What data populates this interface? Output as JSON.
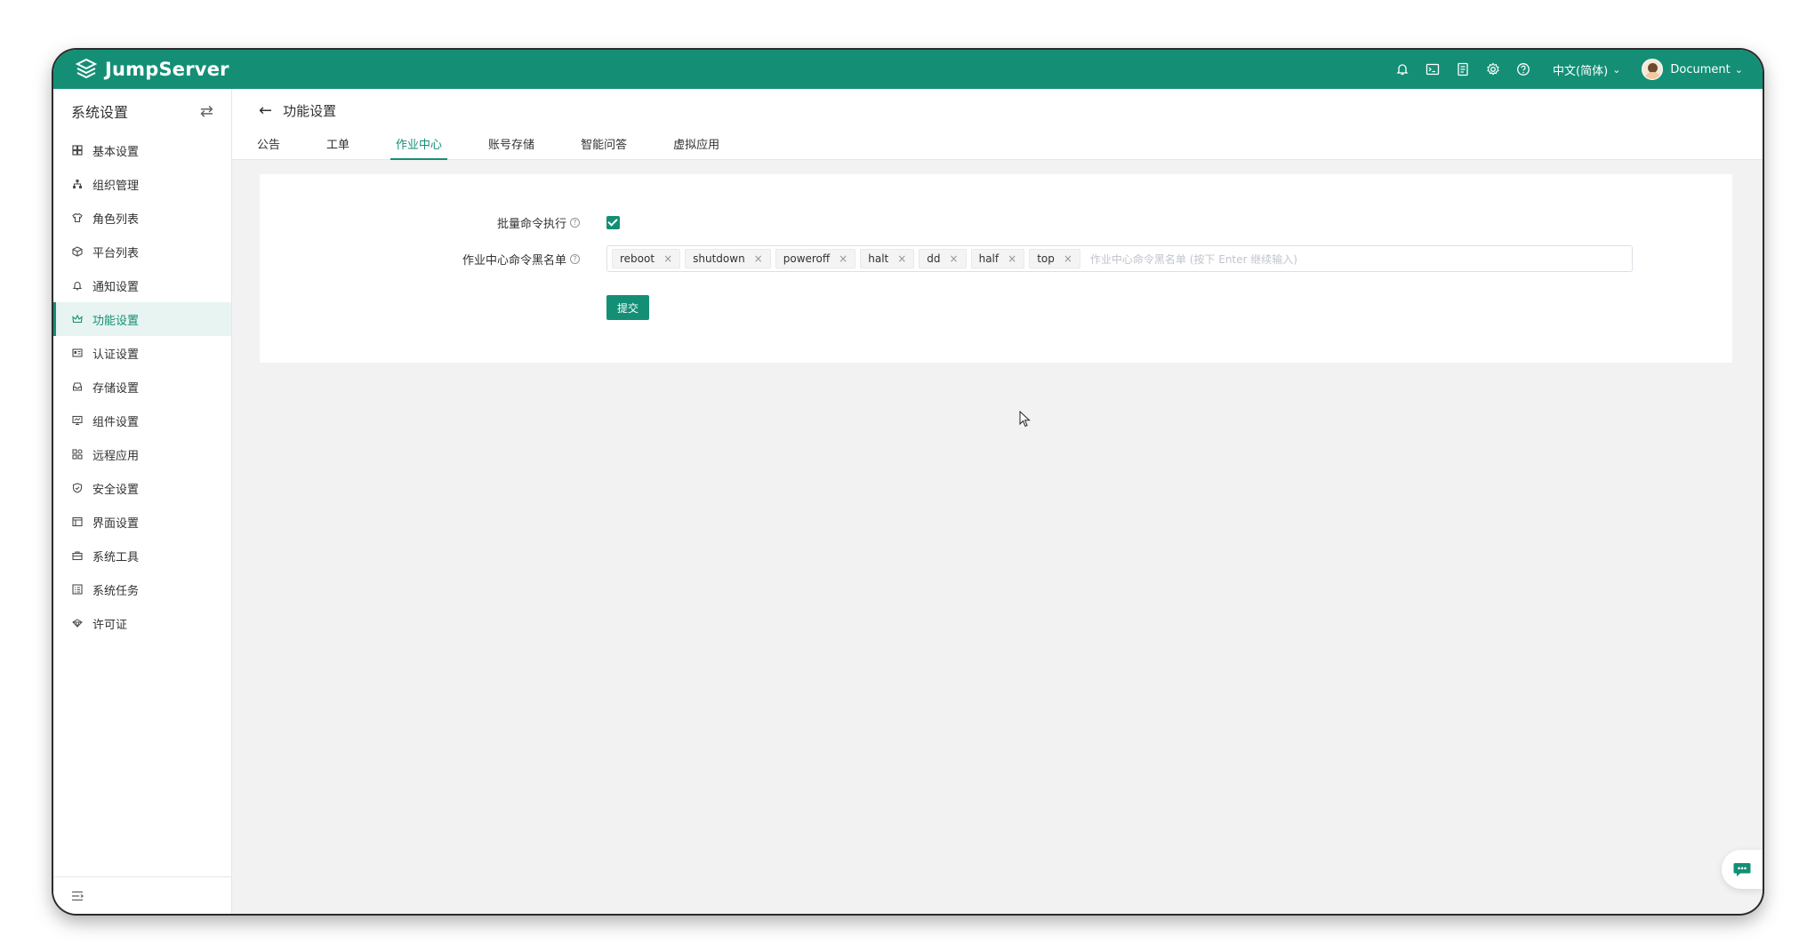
{
  "header": {
    "brand": "JumpServer",
    "language": "中文(简体)",
    "user": "Document"
  },
  "sidebar": {
    "title": "系统设置",
    "items": [
      {
        "label": "基本设置",
        "icon": "grid-icon"
      },
      {
        "label": "组织管理",
        "icon": "org-tree-icon"
      },
      {
        "label": "角色列表",
        "icon": "shirt-icon"
      },
      {
        "label": "平台列表",
        "icon": "cube-icon"
      },
      {
        "label": "通知设置",
        "icon": "bell-icon"
      },
      {
        "label": "功能设置",
        "icon": "crown-icon"
      },
      {
        "label": "认证设置",
        "icon": "id-card-icon"
      },
      {
        "label": "存储设置",
        "icon": "inbox-icon"
      },
      {
        "label": "组件设置",
        "icon": "monitor-icon"
      },
      {
        "label": "远程应用",
        "icon": "apps-icon"
      },
      {
        "label": "安全设置",
        "icon": "shield-icon"
      },
      {
        "label": "界面设置",
        "icon": "layout-icon"
      },
      {
        "label": "系统工具",
        "icon": "toolbox-icon"
      },
      {
        "label": "系统任务",
        "icon": "task-list-icon"
      },
      {
        "label": "许可证",
        "icon": "license-icon"
      }
    ],
    "active_index": 5
  },
  "page": {
    "title": "功能设置",
    "tabs": [
      "公告",
      "工单",
      "作业中心",
      "账号存储",
      "智能问答",
      "虚拟应用"
    ],
    "active_tab": 2
  },
  "form": {
    "batch_label": "批量命令执行",
    "batch_checked": true,
    "blacklist_label": "作业中心命令黑名单",
    "tags": [
      "reboot",
      "shutdown",
      "poweroff",
      "halt",
      "dd",
      "half",
      "top"
    ],
    "placeholder": "作业中心命令黑名单 (按下 Enter 继续输入)",
    "submit_label": "提交"
  },
  "colors": {
    "brand": "#148f76",
    "background": "#f2f2f2"
  }
}
